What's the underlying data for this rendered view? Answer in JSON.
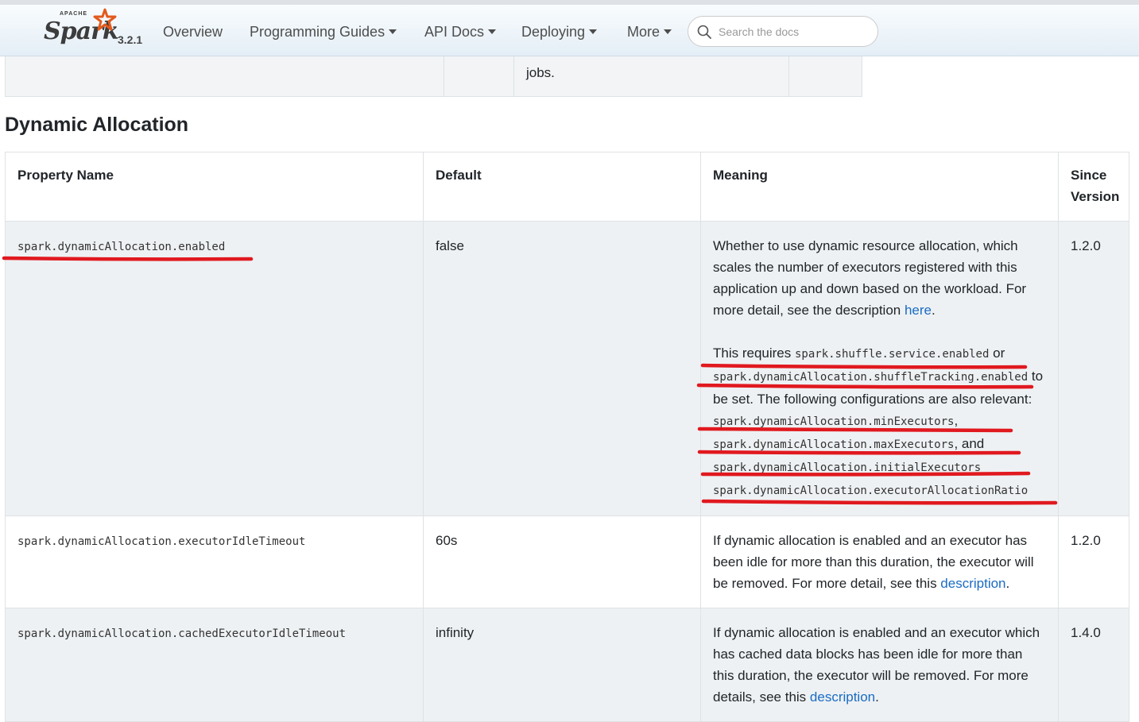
{
  "header": {
    "logo": {
      "apache": "APACHE",
      "name": "Spark",
      "version": "3.2.1"
    },
    "nav": {
      "overview": "Overview",
      "programming_guides": "Programming Guides",
      "api_docs": "API Docs",
      "deploying": "Deploying",
      "more": "More"
    },
    "search": {
      "placeholder": "Search the docs",
      "value": ""
    }
  },
  "previous_table": {
    "visible_text": "jobs."
  },
  "section": {
    "title": "Dynamic Allocation"
  },
  "table": {
    "headers": {
      "property": "Property Name",
      "default": "Default",
      "meaning": "Meaning",
      "since": "Since Version"
    },
    "rows": [
      {
        "property": "spark.dynamicAllocation.enabled",
        "default": "false",
        "meaning": {
          "p1": "Whether to use dynamic resource allocation, which scales the number of executors registered with this application up and down based on the workload. For more detail, see the description ",
          "p1_link": "here",
          "p1_end": ".",
          "p2_a": "This requires ",
          "p2_code1": "spark.shuffle.service.enabled",
          "p2_b": " or ",
          "p2_code2": "spark.dynamicAllocation.shuffleTracking.enabled",
          "p2_c": " to be set. The following configurations are also relevant: ",
          "code_min": "spark.dynamicAllocation.minExecutors",
          "sep1": ", ",
          "code_max": "spark.dynamicAllocation.maxExecutors",
          "sep2": ", and ",
          "code_initial": "spark.dynamicAllocation.initialExecutors",
          "code_ratio": "spark.dynamicAllocation.executorAllocationRatio"
        },
        "since": "1.2.0"
      },
      {
        "property": "spark.dynamicAllocation.executorIdleTimeout",
        "default": "60s",
        "meaning": {
          "text": "If dynamic allocation is enabled and an executor has been idle for more than this duration, the executor will be removed. For more detail, see this ",
          "link": "description",
          "end": "."
        },
        "since": "1.2.0"
      },
      {
        "property": "spark.dynamicAllocation.cachedExecutorIdleTimeout",
        "default": "infinity",
        "meaning": {
          "text": "If dynamic allocation is enabled and an executor which has cached data blocks has been idle for more than this duration, the executor will be removed. For more details, see this ",
          "link": "description",
          "end": "."
        },
        "since": "1.4.0"
      }
    ]
  },
  "colors": {
    "annotation": "#e0191f",
    "link": "#1a6cc4",
    "brand": "#e25a1c"
  }
}
